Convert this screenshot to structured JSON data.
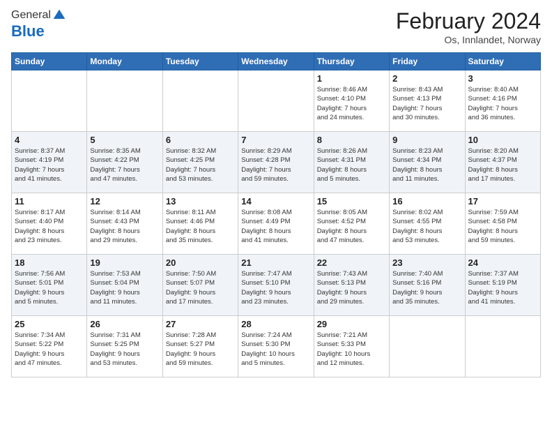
{
  "header": {
    "logo_general": "General",
    "logo_blue": "Blue",
    "month_title": "February 2024",
    "location": "Os, Innlandet, Norway"
  },
  "days_of_week": [
    "Sunday",
    "Monday",
    "Tuesday",
    "Wednesday",
    "Thursday",
    "Friday",
    "Saturday"
  ],
  "weeks": [
    [
      {
        "day": "",
        "info": ""
      },
      {
        "day": "",
        "info": ""
      },
      {
        "day": "",
        "info": ""
      },
      {
        "day": "",
        "info": ""
      },
      {
        "day": "1",
        "info": "Sunrise: 8:46 AM\nSunset: 4:10 PM\nDaylight: 7 hours\nand 24 minutes."
      },
      {
        "day": "2",
        "info": "Sunrise: 8:43 AM\nSunset: 4:13 PM\nDaylight: 7 hours\nand 30 minutes."
      },
      {
        "day": "3",
        "info": "Sunrise: 8:40 AM\nSunset: 4:16 PM\nDaylight: 7 hours\nand 36 minutes."
      }
    ],
    [
      {
        "day": "4",
        "info": "Sunrise: 8:37 AM\nSunset: 4:19 PM\nDaylight: 7 hours\nand 41 minutes."
      },
      {
        "day": "5",
        "info": "Sunrise: 8:35 AM\nSunset: 4:22 PM\nDaylight: 7 hours\nand 47 minutes."
      },
      {
        "day": "6",
        "info": "Sunrise: 8:32 AM\nSunset: 4:25 PM\nDaylight: 7 hours\nand 53 minutes."
      },
      {
        "day": "7",
        "info": "Sunrise: 8:29 AM\nSunset: 4:28 PM\nDaylight: 7 hours\nand 59 minutes."
      },
      {
        "day": "8",
        "info": "Sunrise: 8:26 AM\nSunset: 4:31 PM\nDaylight: 8 hours\nand 5 minutes."
      },
      {
        "day": "9",
        "info": "Sunrise: 8:23 AM\nSunset: 4:34 PM\nDaylight: 8 hours\nand 11 minutes."
      },
      {
        "day": "10",
        "info": "Sunrise: 8:20 AM\nSunset: 4:37 PM\nDaylight: 8 hours\nand 17 minutes."
      }
    ],
    [
      {
        "day": "11",
        "info": "Sunrise: 8:17 AM\nSunset: 4:40 PM\nDaylight: 8 hours\nand 23 minutes."
      },
      {
        "day": "12",
        "info": "Sunrise: 8:14 AM\nSunset: 4:43 PM\nDaylight: 8 hours\nand 29 minutes."
      },
      {
        "day": "13",
        "info": "Sunrise: 8:11 AM\nSunset: 4:46 PM\nDaylight: 8 hours\nand 35 minutes."
      },
      {
        "day": "14",
        "info": "Sunrise: 8:08 AM\nSunset: 4:49 PM\nDaylight: 8 hours\nand 41 minutes."
      },
      {
        "day": "15",
        "info": "Sunrise: 8:05 AM\nSunset: 4:52 PM\nDaylight: 8 hours\nand 47 minutes."
      },
      {
        "day": "16",
        "info": "Sunrise: 8:02 AM\nSunset: 4:55 PM\nDaylight: 8 hours\nand 53 minutes."
      },
      {
        "day": "17",
        "info": "Sunrise: 7:59 AM\nSunset: 4:58 PM\nDaylight: 8 hours\nand 59 minutes."
      }
    ],
    [
      {
        "day": "18",
        "info": "Sunrise: 7:56 AM\nSunset: 5:01 PM\nDaylight: 9 hours\nand 5 minutes."
      },
      {
        "day": "19",
        "info": "Sunrise: 7:53 AM\nSunset: 5:04 PM\nDaylight: 9 hours\nand 11 minutes."
      },
      {
        "day": "20",
        "info": "Sunrise: 7:50 AM\nSunset: 5:07 PM\nDaylight: 9 hours\nand 17 minutes."
      },
      {
        "day": "21",
        "info": "Sunrise: 7:47 AM\nSunset: 5:10 PM\nDaylight: 9 hours\nand 23 minutes."
      },
      {
        "day": "22",
        "info": "Sunrise: 7:43 AM\nSunset: 5:13 PM\nDaylight: 9 hours\nand 29 minutes."
      },
      {
        "day": "23",
        "info": "Sunrise: 7:40 AM\nSunset: 5:16 PM\nDaylight: 9 hours\nand 35 minutes."
      },
      {
        "day": "24",
        "info": "Sunrise: 7:37 AM\nSunset: 5:19 PM\nDaylight: 9 hours\nand 41 minutes."
      }
    ],
    [
      {
        "day": "25",
        "info": "Sunrise: 7:34 AM\nSunset: 5:22 PM\nDaylight: 9 hours\nand 47 minutes."
      },
      {
        "day": "26",
        "info": "Sunrise: 7:31 AM\nSunset: 5:25 PM\nDaylight: 9 hours\nand 53 minutes."
      },
      {
        "day": "27",
        "info": "Sunrise: 7:28 AM\nSunset: 5:27 PM\nDaylight: 9 hours\nand 59 minutes."
      },
      {
        "day": "28",
        "info": "Sunrise: 7:24 AM\nSunset: 5:30 PM\nDaylight: 10 hours\nand 5 minutes."
      },
      {
        "day": "29",
        "info": "Sunrise: 7:21 AM\nSunset: 5:33 PM\nDaylight: 10 hours\nand 12 minutes."
      },
      {
        "day": "",
        "info": ""
      },
      {
        "day": "",
        "info": ""
      }
    ]
  ]
}
